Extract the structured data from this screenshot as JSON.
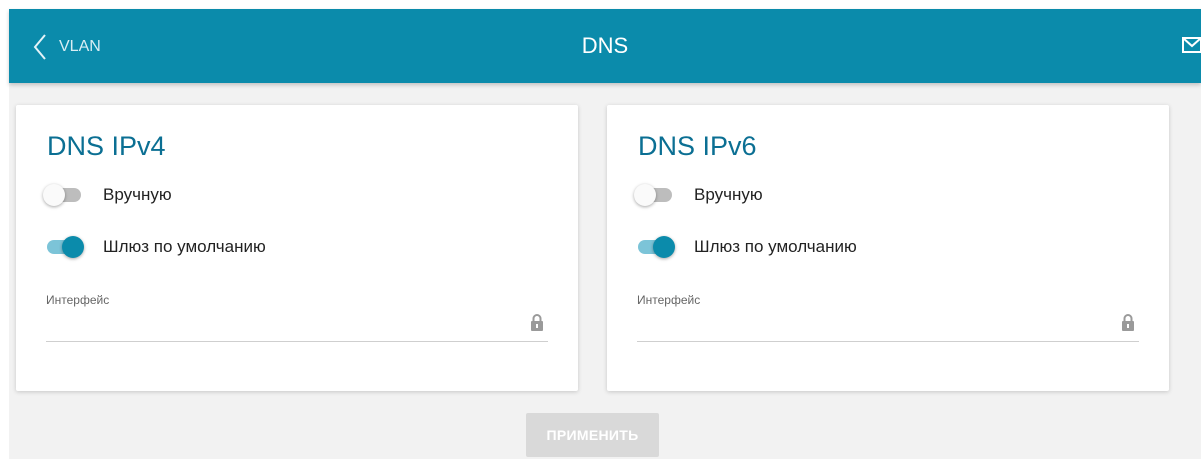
{
  "header": {
    "back_label": "VLAN",
    "title": "DNS",
    "color": "#0b8bab"
  },
  "cards": [
    {
      "title": "DNS IPv4",
      "manual": {
        "label": "Вручную",
        "on": false
      },
      "gateway": {
        "label": "Шлюз по умолчанию",
        "on": true
      },
      "interface": {
        "label": "Интерфейс",
        "value": "",
        "locked": true
      }
    },
    {
      "title": "DNS IPv6",
      "manual": {
        "label": "Вручную",
        "on": false
      },
      "gateway": {
        "label": "Шлюз по умолчанию",
        "on": true
      },
      "interface": {
        "label": "Интерфейс",
        "value": "",
        "locked": true
      }
    }
  ],
  "apply_button": {
    "label": "ПРИМЕНИТЬ",
    "enabled": false
  },
  "icons": {
    "back": "chevron-left-icon",
    "mail": "envelope-icon",
    "lock": "lock-icon"
  }
}
